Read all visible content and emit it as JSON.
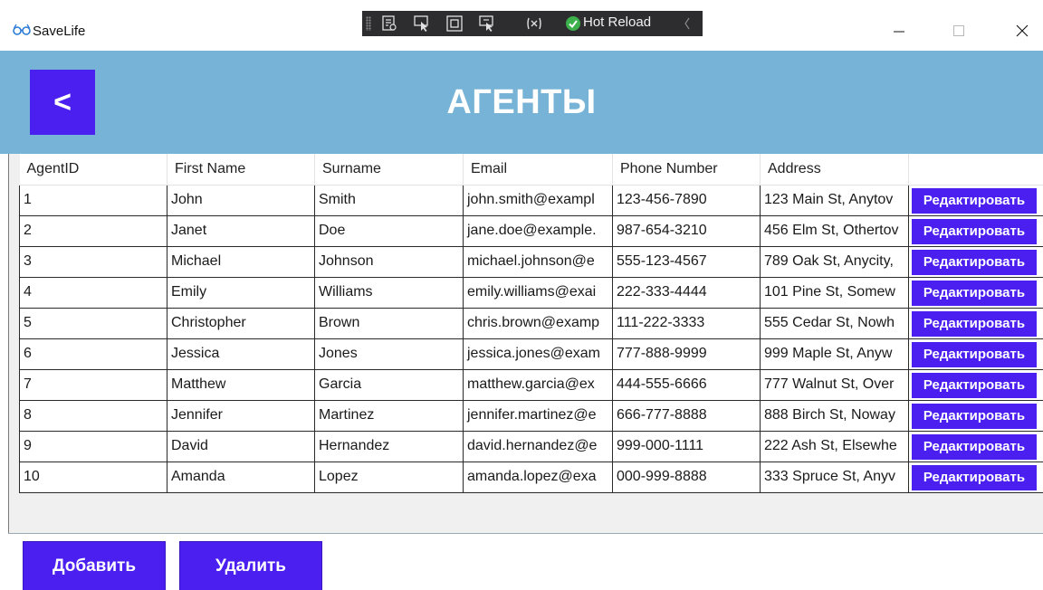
{
  "window": {
    "title": "SaveLife",
    "icon": "glasses-icon",
    "controls": [
      "minimize-icon",
      "maximize-icon",
      "close-icon"
    ]
  },
  "devtoolbar": {
    "icons": [
      "live-visual-tree-icon",
      "select-element-icon",
      "display-adorners-icon",
      "track-focus-icon",
      "binding-failures-icon"
    ],
    "hot_reload_label": "Hot Reload",
    "hot_reload_status_color": "#3cb04a"
  },
  "header": {
    "back_label": "<",
    "title": "АГЕНТЫ",
    "background": "#77b3d6",
    "accent": "#4b1ff0"
  },
  "grid": {
    "columns": [
      "AgentID",
      "First Name",
      "Surname",
      "Email",
      "Phone Number",
      "Address",
      ""
    ],
    "edit_label": "Редактировать",
    "rows": [
      {
        "id": "1",
        "first": "John",
        "surname": "Smith",
        "email": "john.smith@exampl",
        "phone": "123-456-7890",
        "address": "123 Main St, Anytov"
      },
      {
        "id": "2",
        "first": "Janet",
        "surname": "Doe",
        "email": "jane.doe@example.",
        "phone": "987-654-3210",
        "address": "456 Elm St, Othertov"
      },
      {
        "id": "3",
        "first": "Michael",
        "surname": "Johnson",
        "email": "michael.johnson@e",
        "phone": "555-123-4567",
        "address": "789 Oak St, Anycity,"
      },
      {
        "id": "4",
        "first": "Emily",
        "surname": "Williams",
        "email": "emily.williams@exai",
        "phone": "222-333-4444",
        "address": "101 Pine St, Somew"
      },
      {
        "id": "5",
        "first": "Christopher",
        "surname": "Brown",
        "email": "chris.brown@examp",
        "phone": "111-222-3333",
        "address": "555 Cedar St, Nowh"
      },
      {
        "id": "6",
        "first": "Jessica",
        "surname": "Jones",
        "email": "jessica.jones@exam",
        "phone": "777-888-9999",
        "address": "999 Maple St, Anyw"
      },
      {
        "id": "7",
        "first": "Matthew",
        "surname": "Garcia",
        "email": "matthew.garcia@ex",
        "phone": "444-555-6666",
        "address": "777 Walnut St, Over"
      },
      {
        "id": "8",
        "first": "Jennifer",
        "surname": "Martinez",
        "email": "jennifer.martinez@e",
        "phone": "666-777-8888",
        "address": "888 Birch St, Noway"
      },
      {
        "id": "9",
        "first": "David",
        "surname": "Hernandez",
        "email": "david.hernandez@e",
        "phone": "999-000-1111",
        "address": "222 Ash St, Elsewhe"
      },
      {
        "id": "10",
        "first": "Amanda",
        "surname": "Lopez",
        "email": "amanda.lopez@exa",
        "phone": "000-999-8888",
        "address": "333 Spruce St, Anyv"
      }
    ]
  },
  "footer": {
    "add_label": "Добавить",
    "delete_label": "Удалить"
  }
}
